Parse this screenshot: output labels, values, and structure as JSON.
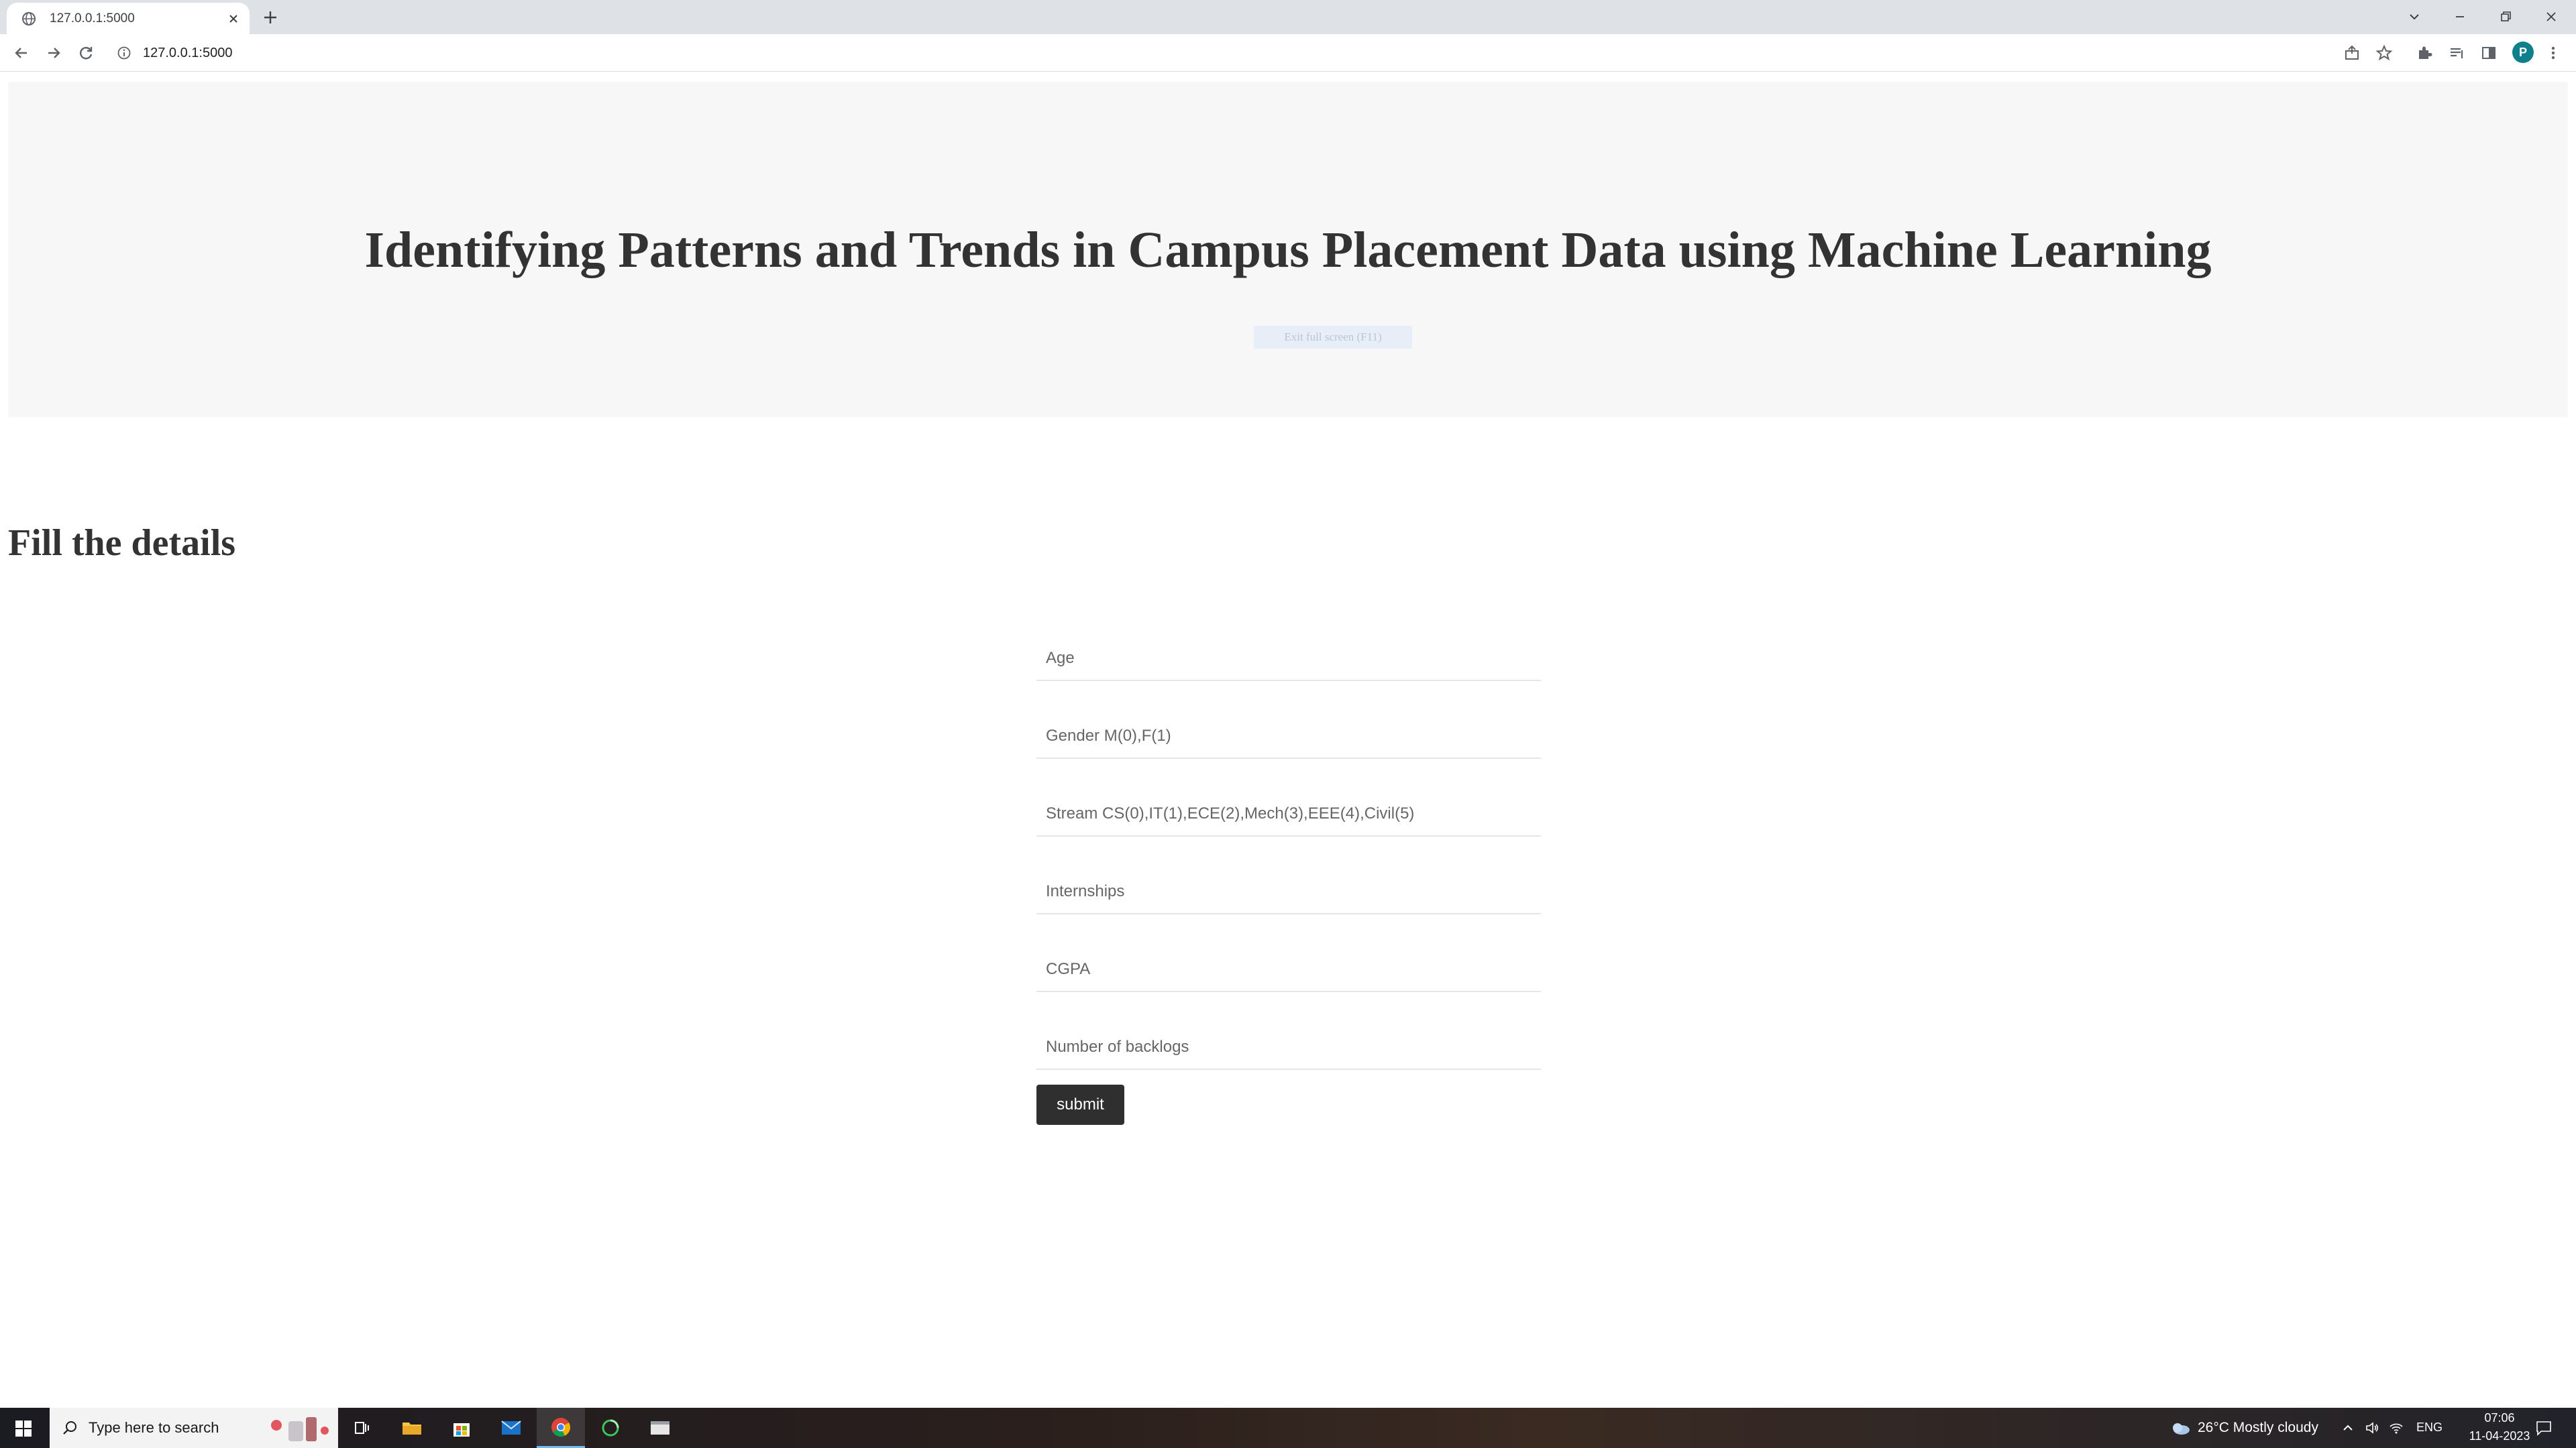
{
  "browser": {
    "tab_title": "127.0.0.1:5000",
    "url": "127.0.0.1:5000",
    "profile_initial": "P"
  },
  "hero": {
    "title": "Identifying Patterns and Trends in Campus Placement Data using Machine Learning",
    "fullscreen_hint": "Exit full screen (F11)"
  },
  "form": {
    "heading": "Fill the details",
    "fields": [
      {
        "placeholder": "Age",
        "value": ""
      },
      {
        "placeholder": "Gender M(0),F(1)",
        "value": ""
      },
      {
        "placeholder": "Stream CS(0),IT(1),ECE(2),Mech(3),EEE(4),Civil(5)",
        "value": ""
      },
      {
        "placeholder": "Internships",
        "value": ""
      },
      {
        "placeholder": "CGPA",
        "value": ""
      },
      {
        "placeholder": "Number of backlogs",
        "value": ""
      }
    ],
    "submit_label": "submit"
  },
  "taskbar": {
    "search_placeholder": "Type here to search",
    "weather": "26°C  Mostly cloudy",
    "language": "ENG",
    "time": "07:06",
    "date": "11-04-2023"
  },
  "colors": {
    "accent_taskbar": "#76b9ed",
    "submit_bg": "#2f2f2f",
    "hero_bg": "#f7f7f7"
  }
}
